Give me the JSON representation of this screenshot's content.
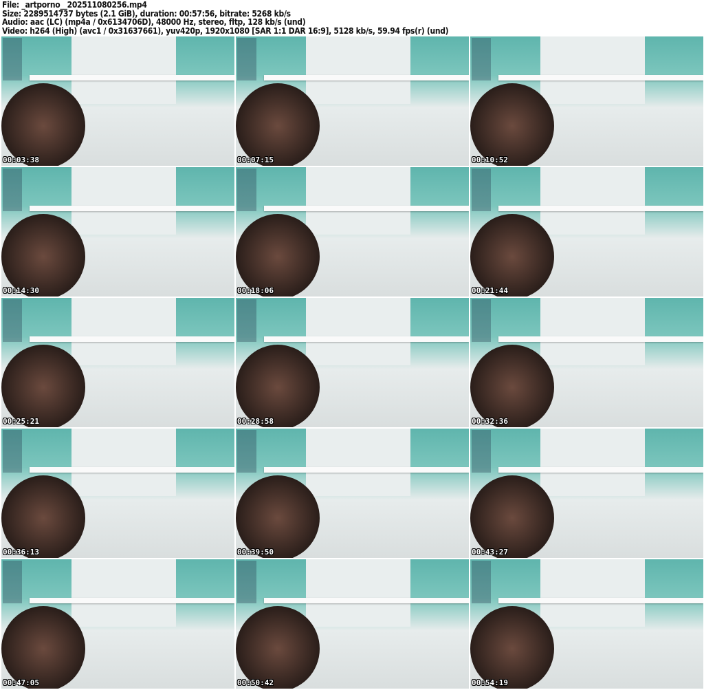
{
  "info": {
    "file": "File: _artporno__202511080256.mp4",
    "size": "Size: 2289514737 bytes (2.1 GiB), duration: 00:57:56, bitrate: 5268 kb/s",
    "audio": "Audio: aac (LC) (mp4a / 0x6134706D), 48000 Hz, stereo, fltp, 128 kb/s (und)",
    "video": "Video: h264 (High) (avc1 / 0x31637661), yuv420p, 1920x1080 [SAR 1:1 DAR 16:9], 5128 kb/s, 59.94 fps(r) (und)"
  },
  "thumbnails": [
    {
      "timestamp": "00:03:38"
    },
    {
      "timestamp": "00:07:15"
    },
    {
      "timestamp": "00:10:52"
    },
    {
      "timestamp": "00:14:30"
    },
    {
      "timestamp": "00:18:06"
    },
    {
      "timestamp": "00:21:44"
    },
    {
      "timestamp": "00:25:21"
    },
    {
      "timestamp": "00:28:58"
    },
    {
      "timestamp": "00:32:36"
    },
    {
      "timestamp": "00:36:13"
    },
    {
      "timestamp": "00:39:50"
    },
    {
      "timestamp": "00:43:27"
    },
    {
      "timestamp": "00:47:05"
    },
    {
      "timestamp": "00:50:42"
    },
    {
      "timestamp": "00:54:19"
    }
  ]
}
